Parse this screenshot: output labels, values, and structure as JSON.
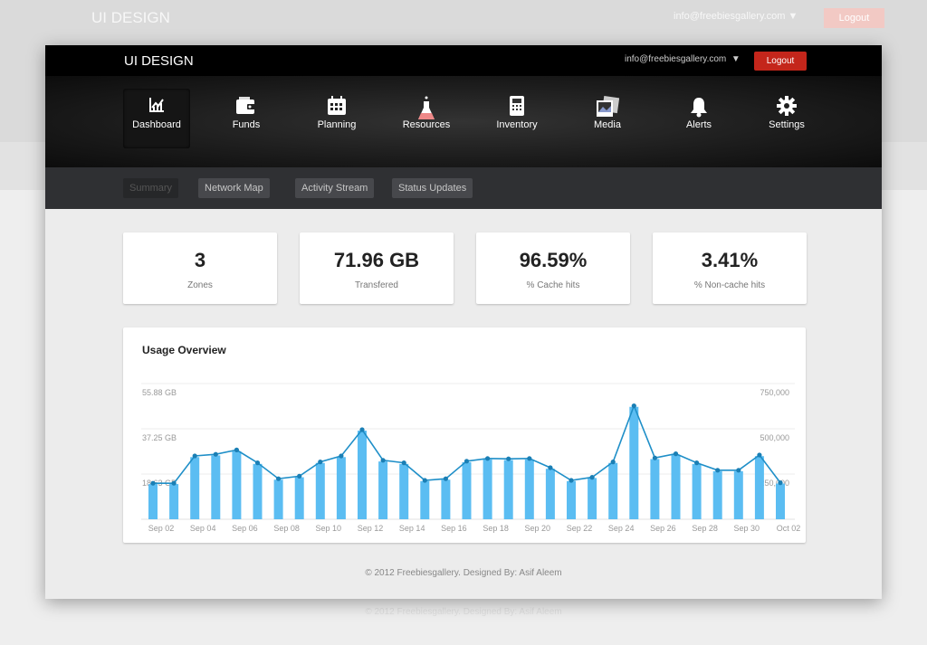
{
  "ghost": {
    "title": "UI DESIGN",
    "email": "info@freebiesgallery.com ▼",
    "logout": "Logout",
    "footer": "© 2012 Freebiesgallery. Designed By: Asif Aleem"
  },
  "header": {
    "title": "UI DESIGN",
    "email": "info@freebiesgallery.com",
    "dropdown_arrow": "▼",
    "logout_label": "Logout",
    "logout_color": "#c4261b"
  },
  "nav": {
    "items": [
      {
        "label": "Dashboard",
        "icon": "chart-icon",
        "active": true
      },
      {
        "label": "Funds",
        "icon": "wallet-icon"
      },
      {
        "label": "Planning",
        "icon": "calendar-icon"
      },
      {
        "label": "Resources",
        "icon": "flask-icon"
      },
      {
        "label": "Inventory",
        "icon": "calculator-icon"
      },
      {
        "label": "Media",
        "icon": "photos-icon"
      },
      {
        "label": "Alerts",
        "icon": "bell-icon"
      },
      {
        "label": "Settings",
        "icon": "gear-icon"
      }
    ]
  },
  "subnav": {
    "tabs": [
      {
        "label": "Summary",
        "active": true
      },
      {
        "label": "Network Map"
      },
      {
        "label": "Activity Stream"
      },
      {
        "label": "Status Updates"
      }
    ]
  },
  "stats": [
    {
      "value": "3",
      "label": "Zones"
    },
    {
      "value": "71.96 GB",
      "label": "Transfered"
    },
    {
      "value": "96.59%",
      "label": "% Cache hits"
    },
    {
      "value": "3.41%",
      "label": "% Non-cache hits"
    }
  ],
  "chart_data": {
    "type": "bar",
    "title": "Usage Overview",
    "left_axis": {
      "ticks": [
        "18.63 GB",
        "37.25 GB",
        "55.88 GB"
      ],
      "range": [
        0,
        55.88
      ]
    },
    "right_axis": {
      "ticks": [
        "250,000",
        "500,000",
        "750,000"
      ],
      "range": [
        0,
        750000
      ]
    },
    "x_tick_labels": [
      "Sep 02",
      "Sep 04",
      "Sep 06",
      "Sep 08",
      "Sep 10",
      "Sep 12",
      "Sep 14",
      "Sep 16",
      "Sep 18",
      "Sep 20",
      "Sep 22",
      "Sep 24",
      "Sep 26",
      "Sep 28",
      "Sep 30",
      "Oct 02"
    ],
    "categories": [
      "Sep 02",
      "Sep 03",
      "Sep 04",
      "Sep 05",
      "Sep 06",
      "Sep 07",
      "Sep 08",
      "Sep 09",
      "Sep 10",
      "Sep 11",
      "Sep 12",
      "Sep 13",
      "Sep 14",
      "Sep 15",
      "Sep 16",
      "Sep 17",
      "Sep 18",
      "Sep 19",
      "Sep 20",
      "Sep 21",
      "Sep 22",
      "Sep 23",
      "Sep 24",
      "Sep 25",
      "Sep 26",
      "Sep 27",
      "Sep 28",
      "Sep 29",
      "Sep 30",
      "Oct 01",
      "Oct 02"
    ],
    "series": [
      {
        "type": "bar",
        "axis": "left",
        "color": "#5bbdf2",
        "values": [
          14.5,
          14.5,
          25.6,
          26.3,
          28.0,
          22.8,
          16.3,
          17.3,
          23.2,
          25.6,
          36.5,
          23.8,
          22.8,
          15.7,
          16.3,
          23.5,
          24.6,
          24.4,
          24.6,
          20.8,
          15.7,
          17.0,
          23.2,
          46.3,
          24.8,
          26.5,
          22.8,
          19.8,
          19.8,
          26.0,
          14.7
        ]
      },
      {
        "type": "line",
        "axis": "right",
        "color": "#1f8fc8",
        "values": [
          199000,
          199000,
          350000,
          359000,
          383000,
          312000,
          224000,
          238000,
          317000,
          350000,
          495000,
          326000,
          312000,
          215000,
          224000,
          321000,
          336000,
          334000,
          336000,
          285000,
          215000,
          232000,
          317000,
          627000,
          339000,
          362000,
          312000,
          271000,
          271000,
          355000,
          202000
        ]
      }
    ],
    "grid": true
  },
  "footer": "© 2012 Freebiesgallery. Designed By: Asif Aleem"
}
